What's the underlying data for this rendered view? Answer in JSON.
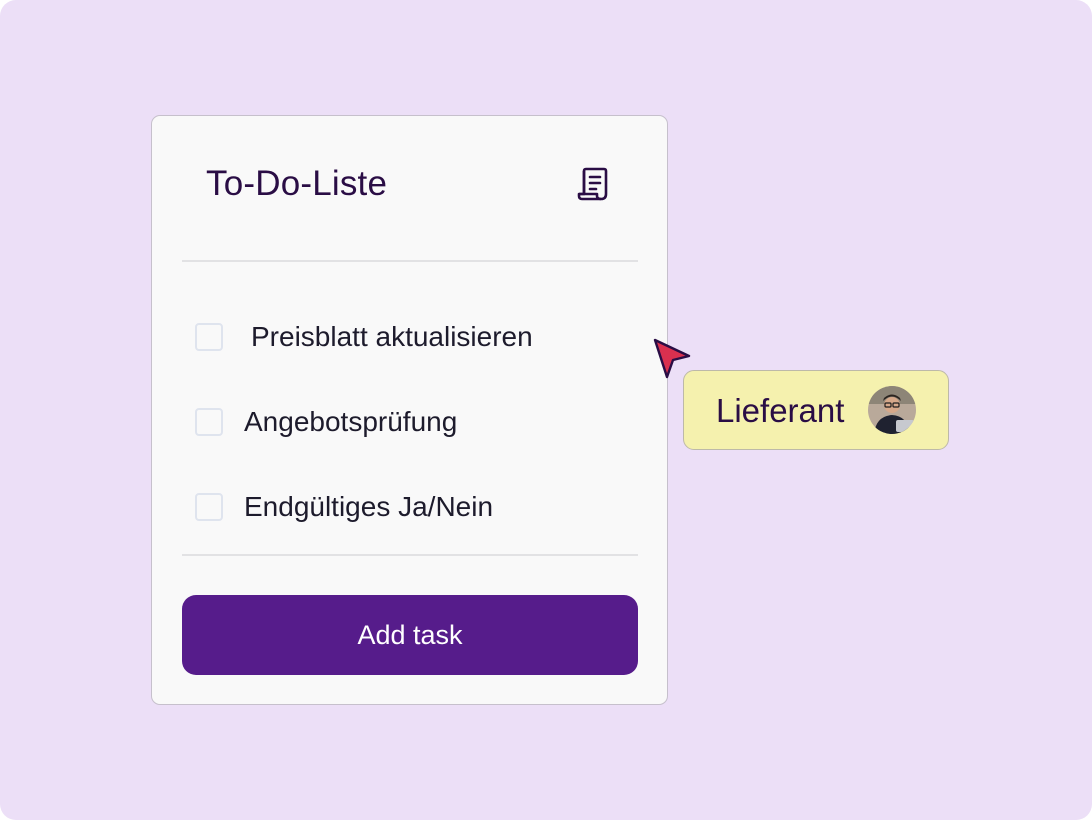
{
  "todo": {
    "title": "To-Do-Liste",
    "title_icon": "document-scroll-icon",
    "tasks": [
      {
        "label": "Preisblatt aktualisieren",
        "checked": false
      },
      {
        "label": "Angebotsprüfung",
        "checked": false
      },
      {
        "label": "Endgültiges Ja/Nein",
        "checked": false
      }
    ],
    "add_button_label": "Add task"
  },
  "collaborator": {
    "label": "Lieferant",
    "avatar_icon": "user-avatar",
    "cursor_icon": "pointer-cursor-icon",
    "tag_color": "#f5f1ae",
    "cursor_color": "#d9304f"
  },
  "colors": {
    "background": "#ecdff7",
    "accent": "#561c8b",
    "title_text": "#2a0d45"
  }
}
